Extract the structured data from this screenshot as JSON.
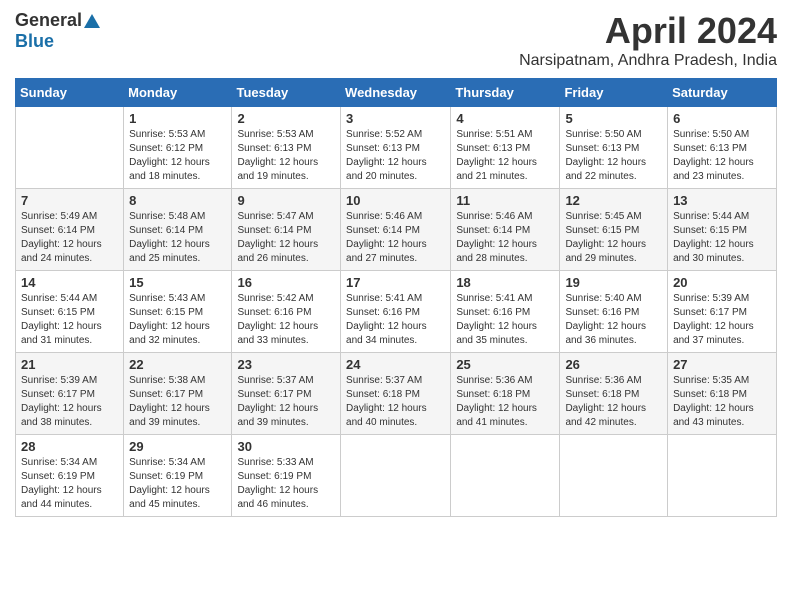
{
  "header": {
    "logo_general": "General",
    "logo_blue": "Blue",
    "title": "April 2024",
    "location": "Narsipatnam, Andhra Pradesh, India"
  },
  "columns": [
    "Sunday",
    "Monday",
    "Tuesday",
    "Wednesday",
    "Thursday",
    "Friday",
    "Saturday"
  ],
  "weeks": [
    [
      {
        "day": "",
        "info": ""
      },
      {
        "day": "1",
        "info": "Sunrise: 5:53 AM\nSunset: 6:12 PM\nDaylight: 12 hours\nand 18 minutes."
      },
      {
        "day": "2",
        "info": "Sunrise: 5:53 AM\nSunset: 6:13 PM\nDaylight: 12 hours\nand 19 minutes."
      },
      {
        "day": "3",
        "info": "Sunrise: 5:52 AM\nSunset: 6:13 PM\nDaylight: 12 hours\nand 20 minutes."
      },
      {
        "day": "4",
        "info": "Sunrise: 5:51 AM\nSunset: 6:13 PM\nDaylight: 12 hours\nand 21 minutes."
      },
      {
        "day": "5",
        "info": "Sunrise: 5:50 AM\nSunset: 6:13 PM\nDaylight: 12 hours\nand 22 minutes."
      },
      {
        "day": "6",
        "info": "Sunrise: 5:50 AM\nSunset: 6:13 PM\nDaylight: 12 hours\nand 23 minutes."
      }
    ],
    [
      {
        "day": "7",
        "info": "Sunrise: 5:49 AM\nSunset: 6:14 PM\nDaylight: 12 hours\nand 24 minutes."
      },
      {
        "day": "8",
        "info": "Sunrise: 5:48 AM\nSunset: 6:14 PM\nDaylight: 12 hours\nand 25 minutes."
      },
      {
        "day": "9",
        "info": "Sunrise: 5:47 AM\nSunset: 6:14 PM\nDaylight: 12 hours\nand 26 minutes."
      },
      {
        "day": "10",
        "info": "Sunrise: 5:46 AM\nSunset: 6:14 PM\nDaylight: 12 hours\nand 27 minutes."
      },
      {
        "day": "11",
        "info": "Sunrise: 5:46 AM\nSunset: 6:14 PM\nDaylight: 12 hours\nand 28 minutes."
      },
      {
        "day": "12",
        "info": "Sunrise: 5:45 AM\nSunset: 6:15 PM\nDaylight: 12 hours\nand 29 minutes."
      },
      {
        "day": "13",
        "info": "Sunrise: 5:44 AM\nSunset: 6:15 PM\nDaylight: 12 hours\nand 30 minutes."
      }
    ],
    [
      {
        "day": "14",
        "info": "Sunrise: 5:44 AM\nSunset: 6:15 PM\nDaylight: 12 hours\nand 31 minutes."
      },
      {
        "day": "15",
        "info": "Sunrise: 5:43 AM\nSunset: 6:15 PM\nDaylight: 12 hours\nand 32 minutes."
      },
      {
        "day": "16",
        "info": "Sunrise: 5:42 AM\nSunset: 6:16 PM\nDaylight: 12 hours\nand 33 minutes."
      },
      {
        "day": "17",
        "info": "Sunrise: 5:41 AM\nSunset: 6:16 PM\nDaylight: 12 hours\nand 34 minutes."
      },
      {
        "day": "18",
        "info": "Sunrise: 5:41 AM\nSunset: 6:16 PM\nDaylight: 12 hours\nand 35 minutes."
      },
      {
        "day": "19",
        "info": "Sunrise: 5:40 AM\nSunset: 6:16 PM\nDaylight: 12 hours\nand 36 minutes."
      },
      {
        "day": "20",
        "info": "Sunrise: 5:39 AM\nSunset: 6:17 PM\nDaylight: 12 hours\nand 37 minutes."
      }
    ],
    [
      {
        "day": "21",
        "info": "Sunrise: 5:39 AM\nSunset: 6:17 PM\nDaylight: 12 hours\nand 38 minutes."
      },
      {
        "day": "22",
        "info": "Sunrise: 5:38 AM\nSunset: 6:17 PM\nDaylight: 12 hours\nand 39 minutes."
      },
      {
        "day": "23",
        "info": "Sunrise: 5:37 AM\nSunset: 6:17 PM\nDaylight: 12 hours\nand 39 minutes."
      },
      {
        "day": "24",
        "info": "Sunrise: 5:37 AM\nSunset: 6:18 PM\nDaylight: 12 hours\nand 40 minutes."
      },
      {
        "day": "25",
        "info": "Sunrise: 5:36 AM\nSunset: 6:18 PM\nDaylight: 12 hours\nand 41 minutes."
      },
      {
        "day": "26",
        "info": "Sunrise: 5:36 AM\nSunset: 6:18 PM\nDaylight: 12 hours\nand 42 minutes."
      },
      {
        "day": "27",
        "info": "Sunrise: 5:35 AM\nSunset: 6:18 PM\nDaylight: 12 hours\nand 43 minutes."
      }
    ],
    [
      {
        "day": "28",
        "info": "Sunrise: 5:34 AM\nSunset: 6:19 PM\nDaylight: 12 hours\nand 44 minutes."
      },
      {
        "day": "29",
        "info": "Sunrise: 5:34 AM\nSunset: 6:19 PM\nDaylight: 12 hours\nand 45 minutes."
      },
      {
        "day": "30",
        "info": "Sunrise: 5:33 AM\nSunset: 6:19 PM\nDaylight: 12 hours\nand 46 minutes."
      },
      {
        "day": "",
        "info": ""
      },
      {
        "day": "",
        "info": ""
      },
      {
        "day": "",
        "info": ""
      },
      {
        "day": "",
        "info": ""
      }
    ]
  ]
}
